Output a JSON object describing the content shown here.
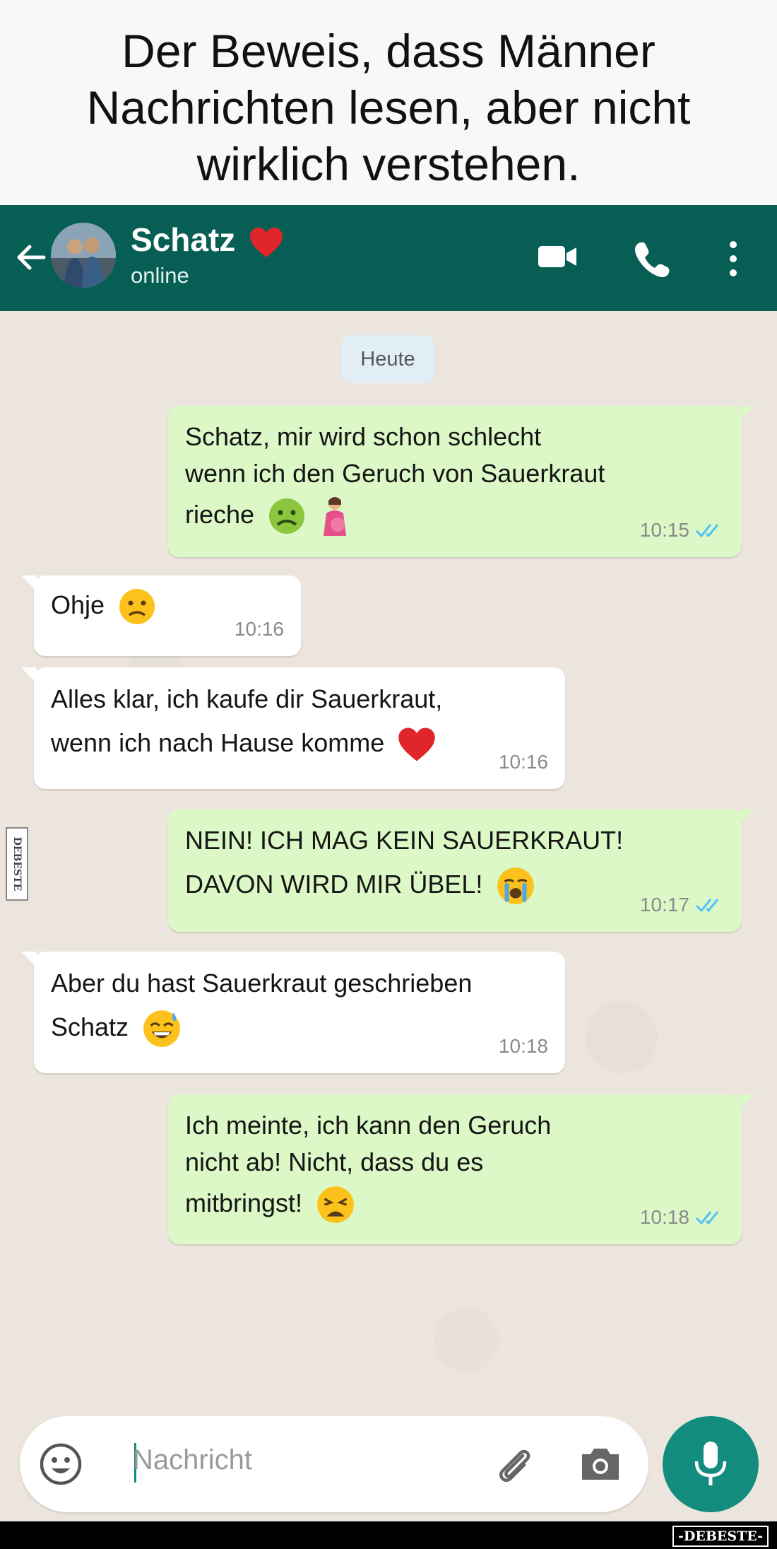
{
  "caption": {
    "line1": "Der Beweis, dass Männer",
    "line2": "Nachrichten lesen, aber nicht",
    "line3": "wirklich verstehen."
  },
  "header": {
    "contact_name": "Schatz",
    "status": "online",
    "color": "#075e54",
    "icons": [
      "back-arrow-icon",
      "video-call-icon",
      "phone-icon",
      "more-vertical-icon",
      "heart-icon"
    ]
  },
  "chat": {
    "day_label": "Heute",
    "messages": [
      {
        "direction": "outgoing",
        "lines": [
          "Schatz, mir wird schon schlecht",
          "wenn ich den Geruch von Sauerkraut",
          "rieche"
        ],
        "emojis": [
          "nauseated-face-emoji",
          "pregnant-woman-emoji"
        ],
        "time": "10:15",
        "read": true
      },
      {
        "direction": "incoming",
        "lines": [
          "Ohje"
        ],
        "emojis": [
          "frowning-face-emoji"
        ],
        "time": "10:16"
      },
      {
        "direction": "incoming",
        "lines": [
          "Alles klar, ich kaufe dir Sauerkraut,",
          "wenn ich nach Hause komme"
        ],
        "emojis": [
          "red-heart-emoji"
        ],
        "time": "10:16"
      },
      {
        "direction": "outgoing",
        "lines": [
          "NEIN! ICH MAG KEIN SAUERKRAUT!",
          "DAVON WIRD MIR ÜBEL!"
        ],
        "emojis": [
          "crying-face-emoji"
        ],
        "time": "10:17",
        "read": true
      },
      {
        "direction": "incoming",
        "lines": [
          "Aber du hast Sauerkraut geschrieben",
          "Schatz"
        ],
        "emojis": [
          "grinning-sweat-emoji"
        ],
        "time": "10:18"
      },
      {
        "direction": "outgoing",
        "lines": [
          "Ich meinte, ich kann den Geruch",
          "nicht ab! Nicht, dass du es",
          "mitbringst!"
        ],
        "emojis": [
          "weary-face-emoji"
        ],
        "time": "10:18",
        "read": true
      }
    ],
    "outgoing_color": "#dcf8c6",
    "incoming_color": "#ffffff",
    "read_tick_color": "#4fc3f7"
  },
  "composer": {
    "placeholder": "Nachricht",
    "icons": [
      "emoji-icon",
      "attach-icon",
      "camera-icon",
      "mic-icon"
    ],
    "accent": "#128c7e"
  },
  "watermark": {
    "bottom": "-DEBESTE-",
    "side": "DEBESTE"
  }
}
